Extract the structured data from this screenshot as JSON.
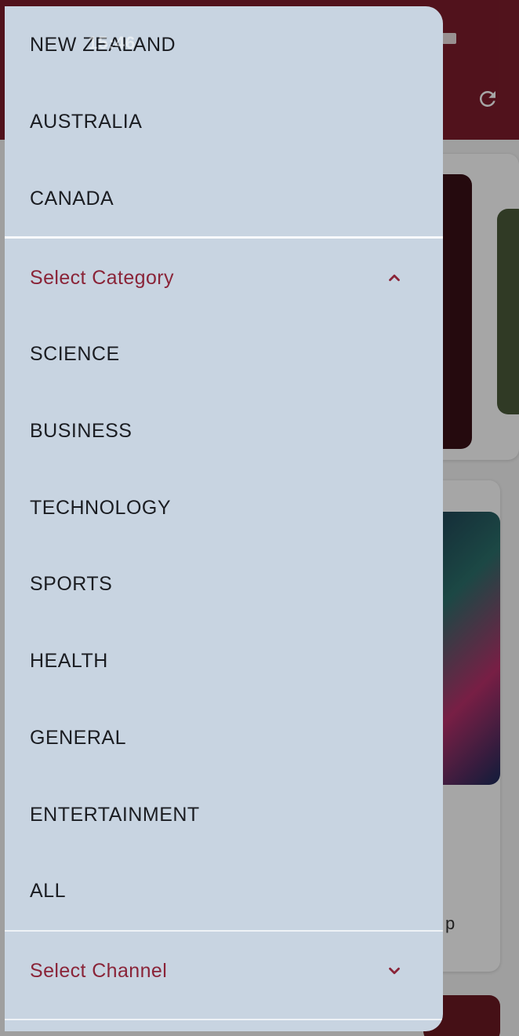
{
  "status_bar": {
    "time": "15:46"
  },
  "drawer": {
    "country_items": [
      "NEW ZEALAND",
      "AUSTRALIA",
      "CANADA"
    ],
    "category_section": {
      "label": "Select Category",
      "expanded": true,
      "items": [
        "SCIENCE",
        "BUSINESS",
        "TECHNOLOGY",
        "SPORTS",
        "HEALTH",
        "GENERAL",
        "ENTERTAINMENT",
        "ALL"
      ]
    },
    "channel_section": {
      "label": "Select Channel",
      "expanded": false
    }
  },
  "background": {
    "card_fragment_text": "p"
  },
  "colors": {
    "drawer_bg": "#c8d4e1",
    "accent": "#8a2438",
    "app_bar": "#7d1d2b",
    "item_text": "#1b1d22"
  },
  "icons": {
    "refresh": "refresh-icon",
    "category_toggle": "chevron-up-icon",
    "channel_toggle": "chevron-down-icon"
  }
}
